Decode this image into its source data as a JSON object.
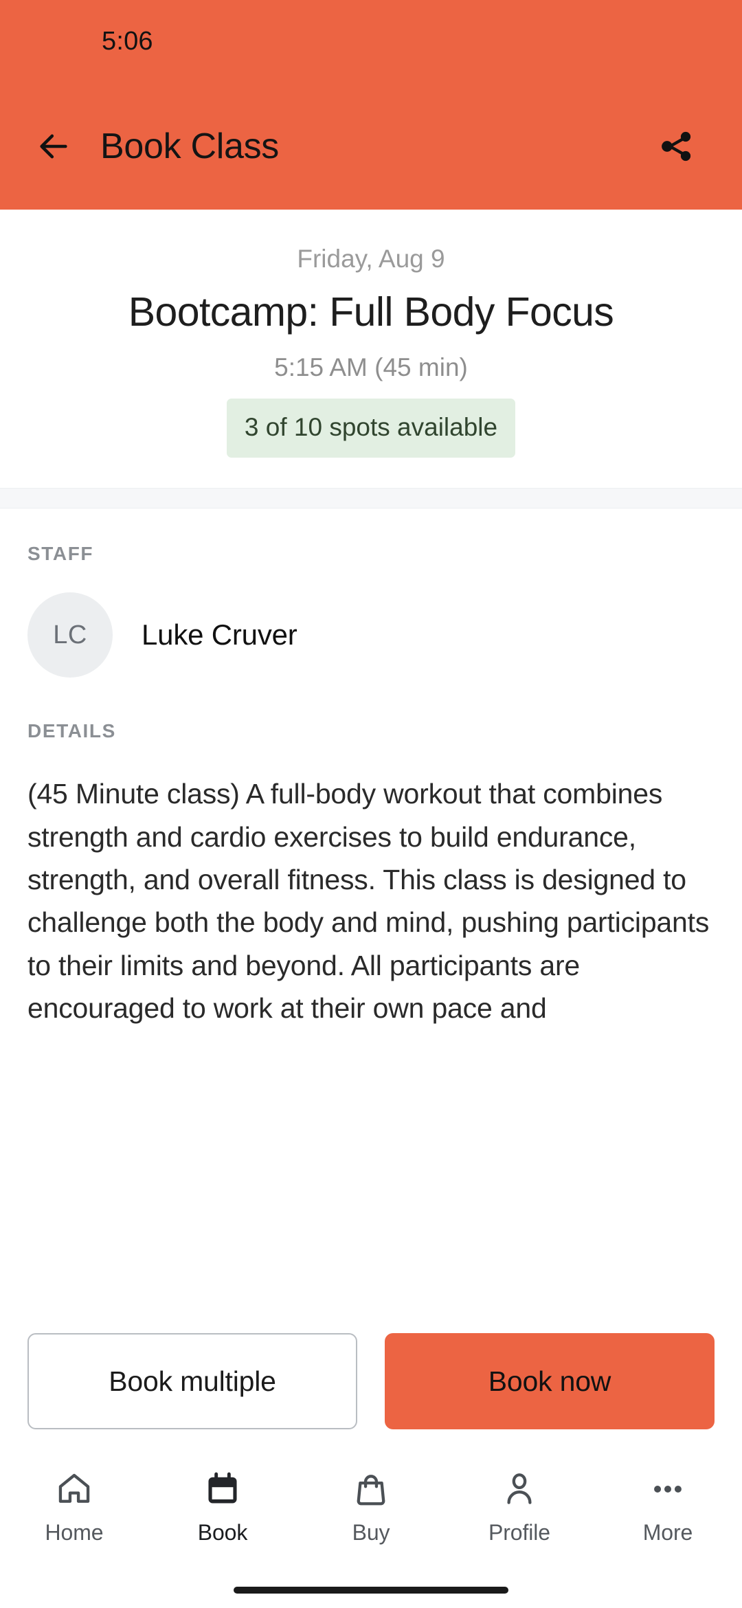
{
  "status_bar": {
    "clock": "5:06"
  },
  "app_bar": {
    "title": "Book Class",
    "back_icon": "arrow-left-icon",
    "share_icon": "share-icon"
  },
  "hero": {
    "date": "Friday, Aug 9",
    "class_title": "Bootcamp: Full Body Focus",
    "time": "5:15 AM (45 min)",
    "spots_badge": "3 of 10 spots available"
  },
  "staff": {
    "section_label": "STAFF",
    "avatar_initials": "LC",
    "name": "Luke Cruver"
  },
  "details": {
    "section_label": "DETAILS",
    "text": "(45 Minute class)  A full-body workout that combines strength and cardio exercises to build endurance, strength, and overall fitness. This class is designed to challenge both the body and mind, pushing participants to their limits and beyond. All participants are encouraged to work at their own pace and"
  },
  "actions": {
    "book_multiple_label": "Book multiple",
    "book_now_label": "Book now"
  },
  "bottom_nav": {
    "items": [
      {
        "label": "Home",
        "icon": "home-icon",
        "active": false
      },
      {
        "label": "Book",
        "icon": "calendar-icon",
        "active": true
      },
      {
        "label": "Buy",
        "icon": "shopping-bag-icon",
        "active": false
      },
      {
        "label": "Profile",
        "icon": "person-icon",
        "active": false
      },
      {
        "label": "More",
        "icon": "ellipsis-icon",
        "active": false
      }
    ]
  },
  "colors": {
    "brand_orange": "#EC6443",
    "badge_green_bg": "#E2EFE2",
    "badge_green_text": "#31452F",
    "avatar_bg": "#ECEEF0",
    "muted_text": "#8E8E8E",
    "section_label": "#8B8F94"
  }
}
